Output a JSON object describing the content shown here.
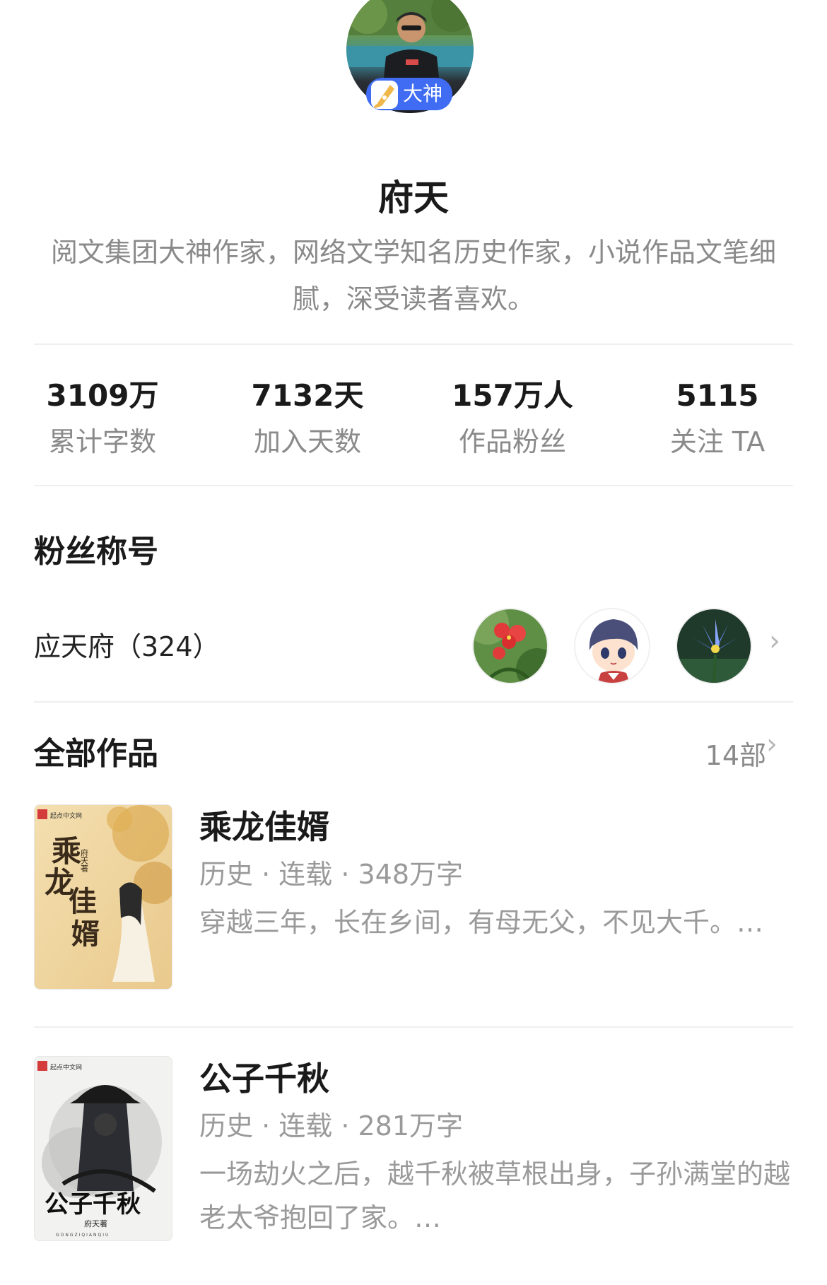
{
  "profile": {
    "name": "府天",
    "badge_label": "大神",
    "bio": "阅文集团大神作家，网络文学知名历史作家，小说作品文笔细腻，深受读者喜欢。"
  },
  "stats": [
    {
      "value": "3109万",
      "label": "累计字数"
    },
    {
      "value": "7132天",
      "label": "加入天数"
    },
    {
      "value": "157万人",
      "label": "作品粉丝"
    },
    {
      "value": "5115",
      "label": "关注 TA"
    }
  ],
  "fan_section": {
    "title": "粉丝称号",
    "fan_title": "应天府（324）",
    "avatars": [
      "flower-avatar",
      "anime-avatar",
      "water-lily-avatar"
    ]
  },
  "works_section": {
    "title": "全部作品",
    "count": "14部"
  },
  "books": [
    {
      "title": "乘龙佳婿",
      "meta": "历史 · 连载 · 348万字",
      "desc": "穿越三年，长在乡间，有母无父，不见大千。…",
      "cover_title": "乘龙佳婿",
      "cover_author": "府天著",
      "cover_publisher": "起点中文网"
    },
    {
      "title": "公子千秋",
      "meta": "历史 · 连载 · 281万字",
      "desc": "一场劫火之后，越千秋被草根出身，子孙满堂的越老太爷抱回了家。…",
      "cover_title": "公子千秋",
      "cover_author": "府天著",
      "cover_publisher": "起点中文网",
      "cover_pinyin": "GONGZIQIANQIU"
    }
  ],
  "colors": {
    "badge": "#3f6cf2",
    "secondary_text": "#8a8a8a",
    "divider": "#efefef"
  }
}
